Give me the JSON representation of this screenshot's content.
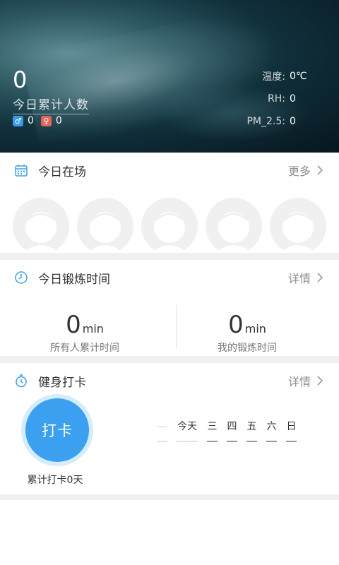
{
  "header": {
    "count": "0",
    "count_label": "今日累计人数",
    "male_count": "0",
    "female_count": "0",
    "env": [
      {
        "label": "温度:",
        "value": "0℃"
      },
      {
        "label": "RH:",
        "value": "0"
      },
      {
        "label": "PM_2.5:",
        "value": "0"
      }
    ]
  },
  "attendance": {
    "title": "今日在场",
    "more": "更多",
    "avatars": 5
  },
  "exercise": {
    "title": "今日锻炼时间",
    "more": "详情",
    "all": {
      "value": "0",
      "unit": "min",
      "label": "所有人累计时间"
    },
    "mine": {
      "value": "0",
      "unit": "min",
      "label": "我的锻炼时间"
    }
  },
  "checkin": {
    "title": "健身打卡",
    "more": "详情",
    "button": "打卡",
    "total": "累计打卡0天",
    "days": [
      "今天",
      "三",
      "四",
      "五",
      "六",
      "日"
    ]
  },
  "colors": {
    "accent": "#3aa0ef",
    "male": "#3a9be8",
    "female": "#e4635e"
  }
}
